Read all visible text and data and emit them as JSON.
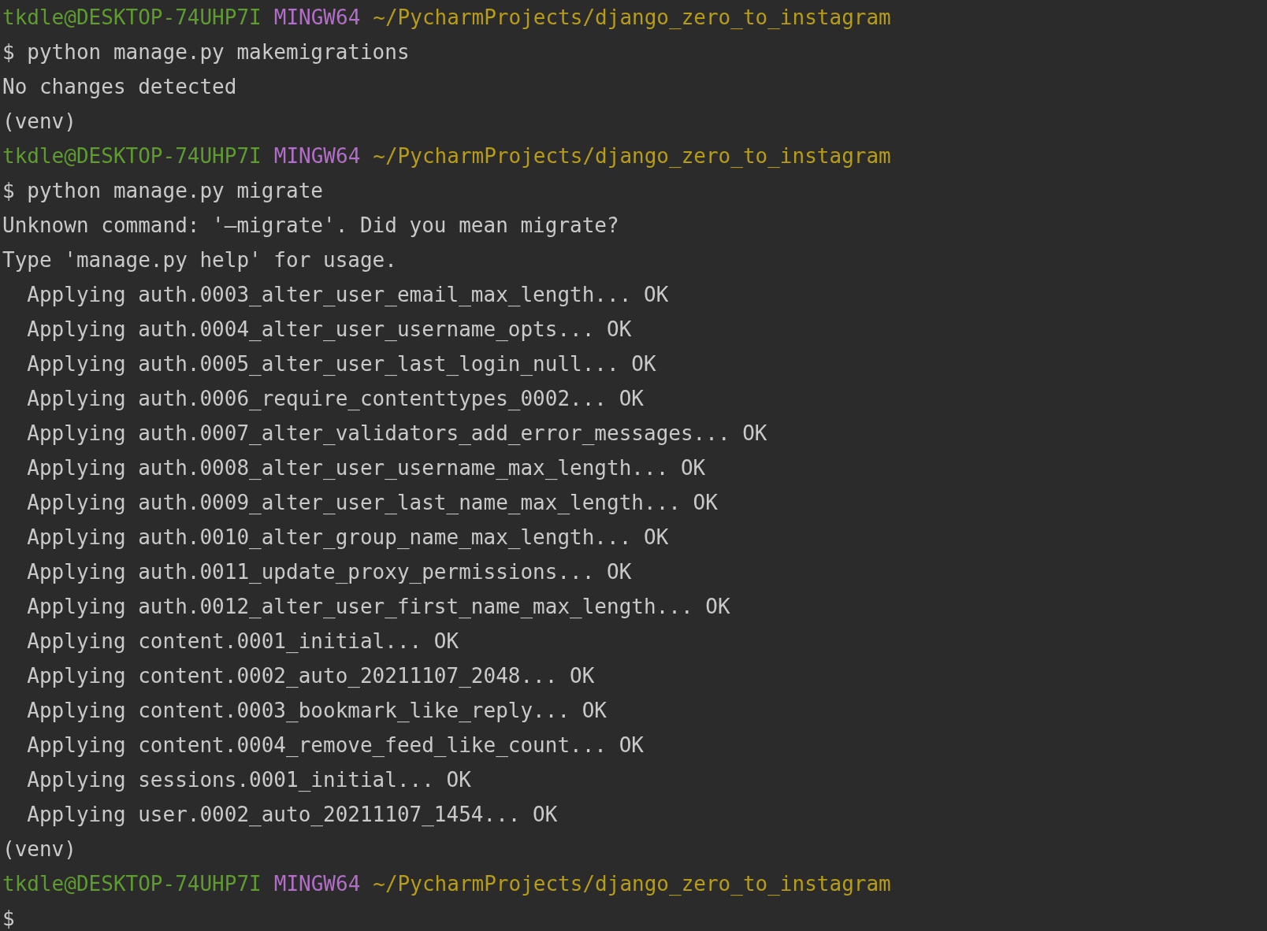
{
  "terminal": {
    "lines": [
      {
        "kind": "prompt",
        "user_host": "tkdle@DESKTOP-74UHP7I",
        "shell": "MINGW64",
        "path": "~/PycharmProjects/django_zero_to_instagram"
      },
      {
        "kind": "output",
        "text": "$ python manage.py makemigrations"
      },
      {
        "kind": "output",
        "text": "No changes detected"
      },
      {
        "kind": "output",
        "text": "(venv)"
      },
      {
        "kind": "prompt",
        "user_host": "tkdle@DESKTOP-74UHP7I",
        "shell": "MINGW64",
        "path": "~/PycharmProjects/django_zero_to_instagram"
      },
      {
        "kind": "output",
        "text": "$ python manage.py migrate"
      },
      {
        "kind": "output",
        "text": "Unknown command: '—migrate'. Did you mean migrate?"
      },
      {
        "kind": "output",
        "text": "Type 'manage.py help' for usage."
      },
      {
        "kind": "output",
        "text": "  Applying auth.0003_alter_user_email_max_length... OK"
      },
      {
        "kind": "output",
        "text": "  Applying auth.0004_alter_user_username_opts... OK"
      },
      {
        "kind": "output",
        "text": "  Applying auth.0005_alter_user_last_login_null... OK"
      },
      {
        "kind": "output",
        "text": "  Applying auth.0006_require_contenttypes_0002... OK"
      },
      {
        "kind": "output",
        "text": "  Applying auth.0007_alter_validators_add_error_messages... OK"
      },
      {
        "kind": "output",
        "text": "  Applying auth.0008_alter_user_username_max_length... OK"
      },
      {
        "kind": "output",
        "text": "  Applying auth.0009_alter_user_last_name_max_length... OK"
      },
      {
        "kind": "output",
        "text": "  Applying auth.0010_alter_group_name_max_length... OK"
      },
      {
        "kind": "output",
        "text": "  Applying auth.0011_update_proxy_permissions... OK"
      },
      {
        "kind": "output",
        "text": "  Applying auth.0012_alter_user_first_name_max_length... OK"
      },
      {
        "kind": "output",
        "text": "  Applying content.0001_initial... OK"
      },
      {
        "kind": "output",
        "text": "  Applying content.0002_auto_20211107_2048... OK"
      },
      {
        "kind": "output",
        "text": "  Applying content.0003_bookmark_like_reply... OK"
      },
      {
        "kind": "output",
        "text": "  Applying content.0004_remove_feed_like_count... OK"
      },
      {
        "kind": "output",
        "text": "  Applying sessions.0001_initial... OK"
      },
      {
        "kind": "output",
        "text": "  Applying user.0002_auto_20211107_1454... OK"
      },
      {
        "kind": "output",
        "text": "(venv)"
      },
      {
        "kind": "prompt",
        "user_host": "tkdle@DESKTOP-74UHP7I",
        "shell": "MINGW64",
        "path": "~/PycharmProjects/django_zero_to_instagram"
      },
      {
        "kind": "output",
        "text": "$"
      }
    ]
  }
}
